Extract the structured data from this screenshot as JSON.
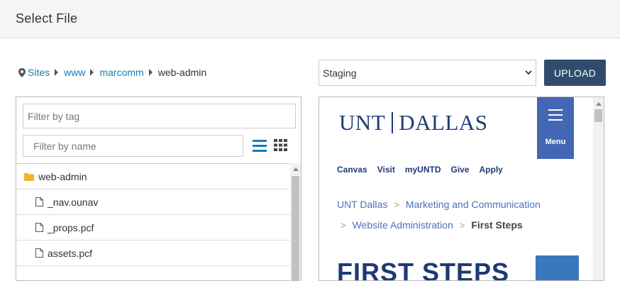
{
  "dialog": {
    "title": "Select File"
  },
  "breadcrumb": {
    "items": [
      "Sites",
      "www",
      "marcomm"
    ],
    "current": "web-admin"
  },
  "environment_select": {
    "selected": "Staging"
  },
  "upload_button": {
    "label": "UPLOAD"
  },
  "filters": {
    "tag_placeholder": "Filter by tag",
    "name_placeholder": "Filter by name"
  },
  "file_list": [
    {
      "name": "web-admin",
      "kind": "folder"
    },
    {
      "name": "_nav.ounav",
      "kind": "file"
    },
    {
      "name": "_props.pcf",
      "kind": "file"
    },
    {
      "name": "assets.pcf",
      "kind": "file"
    }
  ],
  "preview": {
    "logo_left": "UNT",
    "logo_right": "DALLAS",
    "menu_label": "Menu",
    "nav_links": [
      "Canvas",
      "Visit",
      "myUNTD",
      "Give",
      "Apply"
    ],
    "crumbs": {
      "home": "UNT Dallas",
      "section": "Marketing and Communication",
      "sub": "Website Administration",
      "current": "First Steps",
      "separator": ">"
    },
    "heading": "FIRST STEPS"
  },
  "colors": {
    "upload_bg": "#2f4c6e",
    "link": "#1a7bb5",
    "unt_navy": "#1e3a74",
    "menu_blue": "#4367b3",
    "folder_yellow": "#f0b429"
  }
}
